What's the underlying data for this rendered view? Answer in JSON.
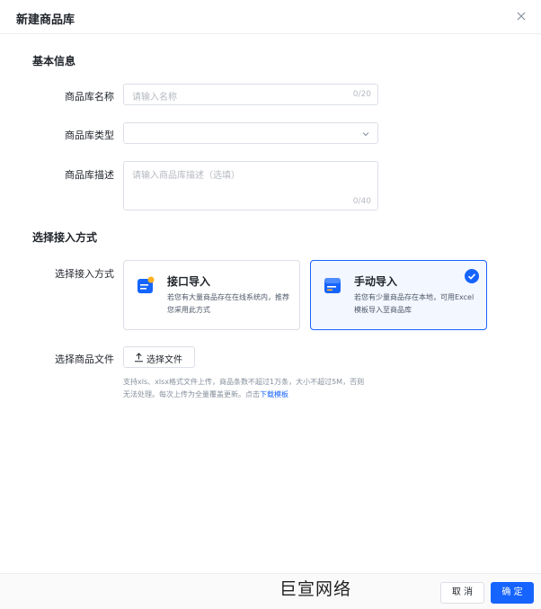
{
  "dialog": {
    "title": "新建商品库"
  },
  "basic_info": {
    "section_title": "基本信息",
    "name_label": "商品库名称",
    "name_placeholder": "请输入名称",
    "name_count": "0/20",
    "type_label": "商品库类型",
    "type_value": "",
    "desc_label": "商品库描述",
    "desc_placeholder": "请输入商品库描述（选填）",
    "desc_count": "0/40"
  },
  "access": {
    "section_title": "选择接入方式",
    "method_label": "选择接入方式",
    "options": [
      {
        "title": "接口导入",
        "desc": "若您有大量商品存在在线系统内，推荐您采用此方式",
        "selected": false,
        "icon": "api-import-icon"
      },
      {
        "title": "手动导入",
        "desc": "若您有少量商品存在本地，可用Excel模板导入至商品库",
        "selected": true,
        "icon": "manual-import-icon"
      }
    ],
    "file_label": "选择商品文件",
    "file_button": "选择文件",
    "hint_text": "支持xls、xlsx格式文件上传，商品条数不超过1万条，大小不超过5M，否则无法处理。每次上传为全量覆盖更新。点击",
    "hint_link": "下载模板"
  },
  "footer": {
    "watermark": "巨宣网络",
    "cancel": "取 消",
    "confirm": "确 定"
  },
  "colors": {
    "primary": "#1664ff",
    "border": "#dcdfe6",
    "placeholder": "#b5b9c0"
  }
}
